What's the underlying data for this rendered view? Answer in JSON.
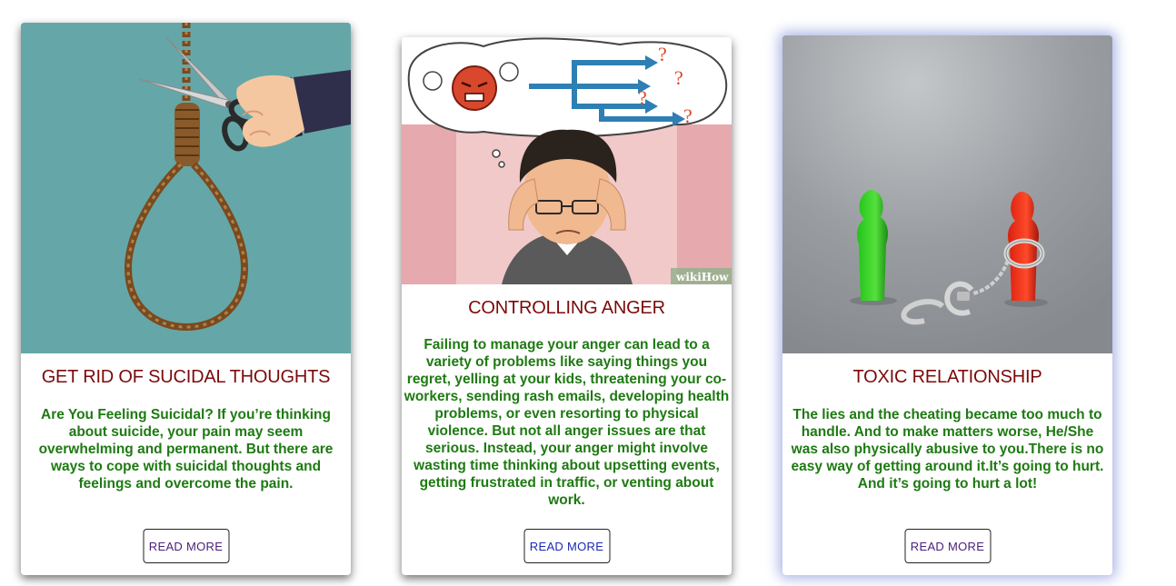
{
  "cards": [
    {
      "title": "GET RID OF SUCIDAL THOUGHTS",
      "text": "Are You Feeling Suicidal? If you’re thinking about suicide, your pain may seem overwhelming and permanent. But there are ways to cope with suicidal thoughts and feelings and overcome the pain.",
      "button": "READ MORE",
      "image": "noose-scissors-illustration"
    },
    {
      "title": "CONTROLLING ANGER",
      "text": "Failing to manage your anger can lead to a variety of problems like saying things you regret, yelling at your kids, threatening your co-workers, sending rash emails, developing health problems, or even resorting to physical violence. But not all anger issues are that serious. Instead, your anger might involve wasting time thinking about upsetting events, getting frustrated in traffic, or venting about work.",
      "button": "READ MORE",
      "image": "stressed-man-illustration",
      "watermark": "wikiHow"
    },
    {
      "title": "TOXIC RELATIONSHIP",
      "text": "The lies and the cheating became too much to handle. And to make matters worse, He/She was also physically abusive to you.There is no easy way of getting around it.It’s going to hurt. And it’s going to hurt a lot!",
      "button": "READ MORE",
      "image": "handcuffed-figures-photo"
    }
  ],
  "colors": {
    "title": "#7b0a0a",
    "text": "#1e7a12",
    "card1_bg": "#65a7a8"
  }
}
